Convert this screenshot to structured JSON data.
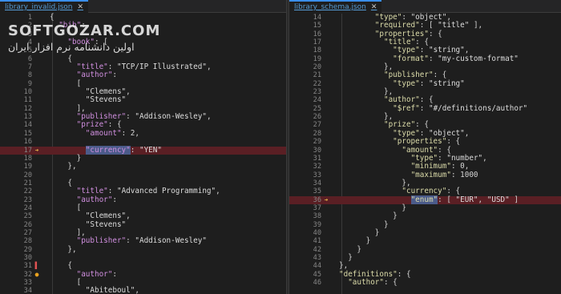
{
  "watermark": {
    "brand": "SOFTGOZAR.COM",
    "tagline": "اولین دانشنامه نرم افزار ایران"
  },
  "left": {
    "tab": "library_invalid.json",
    "markers": {
      "17": "warn-arrow",
      "31": "error-bar",
      "32": "warn-dot"
    },
    "highlight_line": 17,
    "lines": [
      {
        "n": "1",
        "t": [
          [
            "n",
            "{"
          ]
        ]
      },
      {
        "n": "2",
        "t": [
          [
            "n",
            "  "
          ],
          [
            "k",
            "\"bib\""
          ],
          [
            "n",
            ":"
          ]
        ]
      },
      {
        "n": "3",
        "t": [
          [
            "n",
            "  "
          ]
        ]
      },
      {
        "n": "4",
        "t": [
          [
            "n",
            "    "
          ],
          [
            "k",
            "\"book\""
          ],
          [
            "n",
            ": ["
          ]
        ]
      },
      {
        "n": "5",
        "t": [
          [
            "n",
            "    "
          ]
        ]
      },
      {
        "n": "6",
        "t": [
          [
            "n",
            "    {"
          ]
        ]
      },
      {
        "n": "7",
        "t": [
          [
            "n",
            "      "
          ],
          [
            "k",
            "\"title\""
          ],
          [
            "n",
            ": "
          ],
          [
            "s",
            "\"TCP/IP Illustrated\""
          ],
          [
            "n",
            ","
          ]
        ]
      },
      {
        "n": "8",
        "t": [
          [
            "n",
            "      "
          ],
          [
            "k",
            "\"author\""
          ],
          [
            "n",
            ":"
          ]
        ]
      },
      {
        "n": "9",
        "t": [
          [
            "n",
            "      ["
          ]
        ]
      },
      {
        "n": "10",
        "t": [
          [
            "n",
            "        "
          ],
          [
            "s",
            "\"Clemens\""
          ],
          [
            "n",
            ","
          ]
        ]
      },
      {
        "n": "11",
        "t": [
          [
            "n",
            "        "
          ],
          [
            "s",
            "\"Stevens\""
          ]
        ]
      },
      {
        "n": "12",
        "t": [
          [
            "n",
            "      ],"
          ]
        ]
      },
      {
        "n": "13",
        "t": [
          [
            "n",
            "      "
          ],
          [
            "k",
            "\"publisher\""
          ],
          [
            "n",
            ": "
          ],
          [
            "s",
            "\"Addison-Wesley\""
          ],
          [
            "n",
            ","
          ]
        ]
      },
      {
        "n": "14",
        "t": [
          [
            "n",
            "      "
          ],
          [
            "k",
            "\"prize\""
          ],
          [
            "n",
            ": {"
          ]
        ]
      },
      {
        "n": "15",
        "t": [
          [
            "n",
            "        "
          ],
          [
            "k",
            "\"amount\""
          ],
          [
            "n",
            ": 2,"
          ]
        ]
      },
      {
        "n": "16",
        "t": [
          [
            "n",
            "        "
          ]
        ]
      },
      {
        "n": "17",
        "t": [
          [
            "n",
            "        "
          ],
          [
            "khl",
            "\"currency\""
          ],
          [
            "n",
            ": "
          ],
          [
            "s",
            "\"YEN\""
          ]
        ]
      },
      {
        "n": "18",
        "t": [
          [
            "n",
            "      }"
          ]
        ]
      },
      {
        "n": "19",
        "t": [
          [
            "n",
            "    },"
          ]
        ]
      },
      {
        "n": "20",
        "t": [
          [
            "n",
            ""
          ]
        ]
      },
      {
        "n": "21",
        "t": [
          [
            "n",
            "    {"
          ]
        ]
      },
      {
        "n": "22",
        "t": [
          [
            "n",
            "      "
          ],
          [
            "k",
            "\"title\""
          ],
          [
            "n",
            ": "
          ],
          [
            "s",
            "\"Advanced Programming\""
          ],
          [
            "n",
            ","
          ]
        ]
      },
      {
        "n": "23",
        "t": [
          [
            "n",
            "      "
          ],
          [
            "k",
            "\"author\""
          ],
          [
            "n",
            ":"
          ]
        ]
      },
      {
        "n": "24",
        "t": [
          [
            "n",
            "      ["
          ]
        ]
      },
      {
        "n": "25",
        "t": [
          [
            "n",
            "        "
          ],
          [
            "s",
            "\"Clemens\""
          ],
          [
            "n",
            ","
          ]
        ]
      },
      {
        "n": "26",
        "t": [
          [
            "n",
            "        "
          ],
          [
            "s",
            "\"Stevens\""
          ]
        ]
      },
      {
        "n": "27",
        "t": [
          [
            "n",
            "      ],"
          ]
        ]
      },
      {
        "n": "28",
        "t": [
          [
            "n",
            "      "
          ],
          [
            "k",
            "\"publisher\""
          ],
          [
            "n",
            ": "
          ],
          [
            "s",
            "\"Addison-Wesley\""
          ]
        ]
      },
      {
        "n": "29",
        "t": [
          [
            "n",
            "    },"
          ]
        ]
      },
      {
        "n": "30",
        "t": [
          [
            "n",
            ""
          ]
        ]
      },
      {
        "n": "31",
        "t": [
          [
            "n",
            "    {"
          ]
        ]
      },
      {
        "n": "32",
        "t": [
          [
            "n",
            "      "
          ],
          [
            "k",
            "\"author\""
          ],
          [
            "n",
            ":"
          ]
        ]
      },
      {
        "n": "33",
        "t": [
          [
            "n",
            "      ["
          ]
        ]
      },
      {
        "n": "34",
        "t": [
          [
            "n",
            "        "
          ],
          [
            "s",
            "\"Abiteboul\""
          ],
          [
            "n",
            ","
          ]
        ]
      }
    ]
  },
  "right": {
    "tab": "library_schema.json",
    "markers": {
      "36": "warn-arrow"
    },
    "highlight_line": 36,
    "lines": [
      {
        "n": "14",
        "t": [
          [
            "n",
            "        "
          ],
          [
            "ks",
            "\"type\""
          ],
          [
            "n",
            ": "
          ],
          [
            "s",
            "\"object\""
          ],
          [
            "n",
            ","
          ]
        ]
      },
      {
        "n": "15",
        "t": [
          [
            "n",
            "        "
          ],
          [
            "ks",
            "\"required\""
          ],
          [
            "n",
            ": [ "
          ],
          [
            "s",
            "\"title\""
          ],
          [
            "n",
            " ],"
          ]
        ]
      },
      {
        "n": "16",
        "t": [
          [
            "n",
            "        "
          ],
          [
            "ks",
            "\"properties\""
          ],
          [
            "n",
            ": {"
          ]
        ]
      },
      {
        "n": "17",
        "t": [
          [
            "n",
            "          "
          ],
          [
            "ks",
            "\"title\""
          ],
          [
            "n",
            ": {"
          ]
        ]
      },
      {
        "n": "18",
        "t": [
          [
            "n",
            "            "
          ],
          [
            "ks",
            "\"type\""
          ],
          [
            "n",
            ": "
          ],
          [
            "s",
            "\"string\""
          ],
          [
            "n",
            ","
          ]
        ]
      },
      {
        "n": "19",
        "t": [
          [
            "n",
            "            "
          ],
          [
            "ks",
            "\"format\""
          ],
          [
            "n",
            ": "
          ],
          [
            "s",
            "\"my-custom-format\""
          ]
        ]
      },
      {
        "n": "20",
        "t": [
          [
            "n",
            "          },"
          ]
        ]
      },
      {
        "n": "21",
        "t": [
          [
            "n",
            "          "
          ],
          [
            "ks",
            "\"publisher\""
          ],
          [
            "n",
            ": {"
          ]
        ]
      },
      {
        "n": "22",
        "t": [
          [
            "n",
            "            "
          ],
          [
            "ks",
            "\"type\""
          ],
          [
            "n",
            ": "
          ],
          [
            "s",
            "\"string\""
          ]
        ]
      },
      {
        "n": "23",
        "t": [
          [
            "n",
            "          },"
          ]
        ]
      },
      {
        "n": "24",
        "t": [
          [
            "n",
            "          "
          ],
          [
            "ks",
            "\"author\""
          ],
          [
            "n",
            ": {"
          ]
        ]
      },
      {
        "n": "25",
        "t": [
          [
            "n",
            "            "
          ],
          [
            "ks",
            "\"$ref\""
          ],
          [
            "n",
            ": "
          ],
          [
            "s",
            "\"#/definitions/author\""
          ]
        ]
      },
      {
        "n": "26",
        "t": [
          [
            "n",
            "          },"
          ]
        ]
      },
      {
        "n": "27",
        "t": [
          [
            "n",
            "          "
          ],
          [
            "ks",
            "\"prize\""
          ],
          [
            "n",
            ": {"
          ]
        ]
      },
      {
        "n": "28",
        "t": [
          [
            "n",
            "            "
          ],
          [
            "ks",
            "\"type\""
          ],
          [
            "n",
            ": "
          ],
          [
            "s",
            "\"object\""
          ],
          [
            "n",
            ","
          ]
        ]
      },
      {
        "n": "29",
        "t": [
          [
            "n",
            "            "
          ],
          [
            "ks",
            "\"properties\""
          ],
          [
            "n",
            ": {"
          ]
        ]
      },
      {
        "n": "30",
        "t": [
          [
            "n",
            "              "
          ],
          [
            "ks",
            "\"amount\""
          ],
          [
            "n",
            ": {"
          ]
        ]
      },
      {
        "n": "31",
        "t": [
          [
            "n",
            "                "
          ],
          [
            "ks",
            "\"type\""
          ],
          [
            "n",
            ": "
          ],
          [
            "s",
            "\"number\""
          ],
          [
            "n",
            ","
          ]
        ]
      },
      {
        "n": "32",
        "t": [
          [
            "n",
            "                "
          ],
          [
            "ks",
            "\"minimum\""
          ],
          [
            "n",
            ": 0,"
          ]
        ]
      },
      {
        "n": "33",
        "t": [
          [
            "n",
            "                "
          ],
          [
            "ks",
            "\"maximum\""
          ],
          [
            "n",
            ": 1000"
          ]
        ]
      },
      {
        "n": "34",
        "t": [
          [
            "n",
            "              },"
          ]
        ]
      },
      {
        "n": "35",
        "t": [
          [
            "n",
            "              "
          ],
          [
            "ks",
            "\"currency\""
          ],
          [
            "n",
            ": {"
          ]
        ]
      },
      {
        "n": "36",
        "t": [
          [
            "n",
            "                "
          ],
          [
            "kshl",
            "\"enum\""
          ],
          [
            "n",
            ": [ "
          ],
          [
            "s",
            "\"EUR\""
          ],
          [
            "n",
            ", "
          ],
          [
            "s",
            "\"USD\""
          ],
          [
            "n",
            " ]"
          ]
        ]
      },
      {
        "n": "37",
        "t": [
          [
            "n",
            "              }"
          ]
        ]
      },
      {
        "n": "38",
        "t": [
          [
            "n",
            "            }"
          ]
        ]
      },
      {
        "n": "39",
        "t": [
          [
            "n",
            "          }"
          ]
        ]
      },
      {
        "n": "40",
        "t": [
          [
            "n",
            "        }"
          ]
        ]
      },
      {
        "n": "41",
        "t": [
          [
            "n",
            "      }"
          ]
        ]
      },
      {
        "n": "42",
        "t": [
          [
            "n",
            "    }"
          ]
        ]
      },
      {
        "n": "43",
        "t": [
          [
            "n",
            "  }"
          ]
        ]
      },
      {
        "n": "44",
        "t": [
          [
            "n",
            "},"
          ]
        ]
      },
      {
        "n": "45",
        "t": [
          [
            "n",
            ""
          ],
          [
            "ks",
            "\"definitions\""
          ],
          [
            "n",
            ": {"
          ]
        ]
      },
      {
        "n": "46",
        "t": [
          [
            "n",
            "  "
          ],
          [
            "ks",
            "\"author\""
          ],
          [
            "n",
            ": {"
          ]
        ]
      }
    ]
  }
}
